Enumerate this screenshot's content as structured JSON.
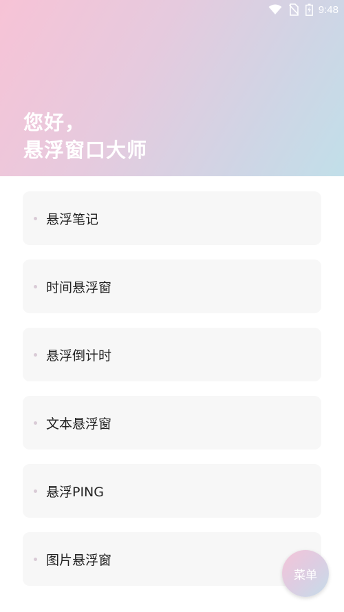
{
  "status_bar": {
    "time": "9:48",
    "icons": [
      "wifi-icon",
      "no-sim-icon",
      "battery-icon"
    ]
  },
  "header": {
    "line1": "您好，",
    "line2": "悬浮窗口大师"
  },
  "menu_items": [
    {
      "label": "悬浮笔记"
    },
    {
      "label": "时间悬浮窗"
    },
    {
      "label": "悬浮倒计时"
    },
    {
      "label": "文本悬浮窗"
    },
    {
      "label": "悬浮PING"
    },
    {
      "label": "图片悬浮窗"
    }
  ],
  "fab": {
    "label": "菜单"
  },
  "colors": {
    "gradient_start": "#f7c3d6",
    "gradient_end": "#c1dfe9",
    "card_bg": "#f7f7f7",
    "dot": "#d9cbd6"
  }
}
